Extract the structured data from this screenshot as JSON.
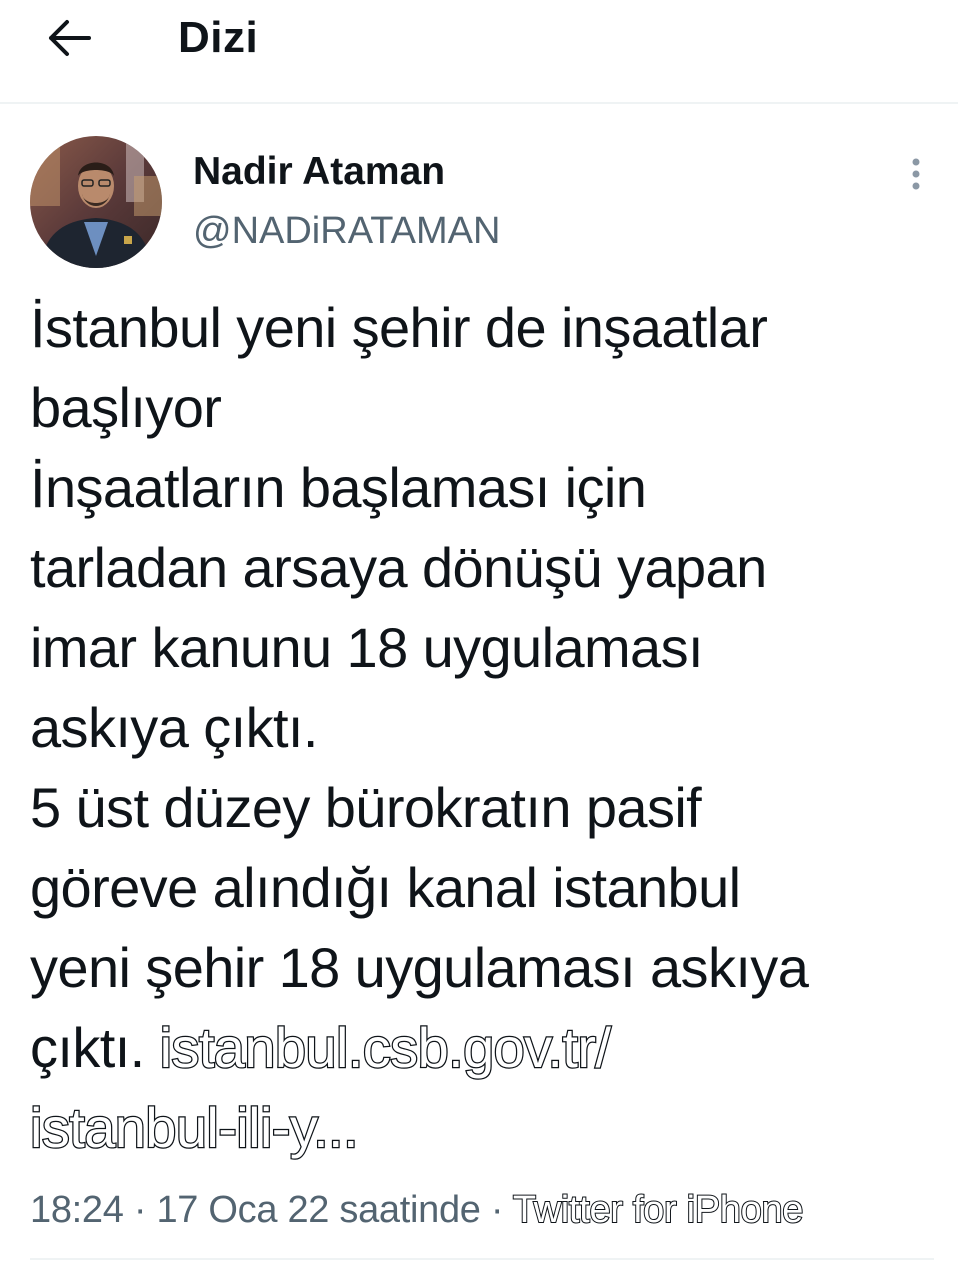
{
  "header": {
    "back_icon": "arrow-left-icon",
    "title": "Dizi"
  },
  "tweet": {
    "author": {
      "display_name": "Nadir Ataman",
      "handle": "@NADiRATAMAN",
      "avatar": "profile-photo"
    },
    "more_icon": "vertical-ellipsis-icon",
    "lines": [
      "İstanbul yeni şehir de inşaatlar",
      "başlıyor",
      "İnşaatların başlaması için",
      "tarladan arsaya dönüşü yapan",
      "imar kanunu 18 uygulaması",
      "askıya çıktı.",
      "5 üst düzey bürokratın pasif",
      "göreve alındığı kanal istanbul",
      "yeni şehir 18 uygulaması askıya"
    ],
    "last_line_prefix": "çıktı. ",
    "link_part1": "istanbul.csb.gov.tr/",
    "link_part2": "istanbul-ili-y...",
    "time": "18:24",
    "separator": " · ",
    "date": "17 Oca 22 saatinde",
    "source": "Twitter for iPhone"
  },
  "colors": {
    "text": "#0f1419",
    "secondary": "#536471",
    "divider": "#eff3f4"
  }
}
